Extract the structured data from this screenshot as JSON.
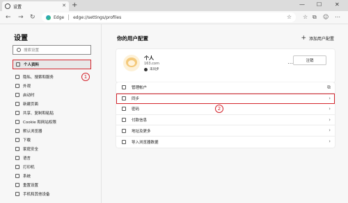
{
  "browser": {
    "tab_title": "设置",
    "tab_close": "✕",
    "new_tab": "+",
    "window_controls": [
      "—",
      "☐",
      "✕"
    ],
    "nav": {
      "back": "←",
      "forward": "→",
      "refresh": "↻"
    },
    "address": {
      "scheme_label": "Edge",
      "url": "edge://settings/profiles",
      "favorite_icon": "☆"
    },
    "toolbar_icons": [
      "☆",
      "⧉",
      "☺",
      "⋯"
    ]
  },
  "sidebar": {
    "title": "设置",
    "search_placeholder": "搜索设置",
    "items": [
      {
        "label": "个人资料",
        "icon": "profile-icon"
      },
      {
        "label": "隐私、搜索和服务",
        "icon": "lock-icon"
      },
      {
        "label": "外观",
        "icon": "appearance-icon"
      },
      {
        "label": "启动时",
        "icon": "power-icon"
      },
      {
        "label": "新建页面",
        "icon": "new-page-icon"
      },
      {
        "label": "共享、复制和粘贴",
        "icon": "share-icon"
      },
      {
        "label": "Cookie 和网站权限",
        "icon": "cookie-icon"
      },
      {
        "label": "默认浏览器",
        "icon": "browser-icon"
      },
      {
        "label": "下载",
        "icon": "download-icon"
      },
      {
        "label": "家庭安全",
        "icon": "family-icon"
      },
      {
        "label": "语言",
        "icon": "language-icon"
      },
      {
        "label": "打印机",
        "icon": "printer-icon"
      },
      {
        "label": "系统",
        "icon": "system-icon"
      },
      {
        "label": "重置设置",
        "icon": "reset-icon"
      },
      {
        "label": "手机和其他设备",
        "icon": "phone-icon"
      }
    ]
  },
  "annotations": {
    "one": "1",
    "two": "2"
  },
  "main": {
    "title": "你的用户配置",
    "add_profile": "添加用户配置",
    "profile": {
      "name": "个人",
      "email": "163.com",
      "sync_status": "未同步",
      "more": "⋯",
      "signout": "注销"
    },
    "rows": [
      {
        "label": "管理帐户",
        "trailing": "⧉"
      },
      {
        "label": "同步",
        "trailing": "›"
      },
      {
        "label": "密码",
        "trailing": "›"
      },
      {
        "label": "付款信息",
        "trailing": "›"
      },
      {
        "label": "地址及更多",
        "trailing": "›"
      },
      {
        "label": "导入浏览器数据",
        "trailing": "›"
      }
    ]
  },
  "colors": {
    "highlight": "#d3242c",
    "accent": "#0a64c8"
  }
}
